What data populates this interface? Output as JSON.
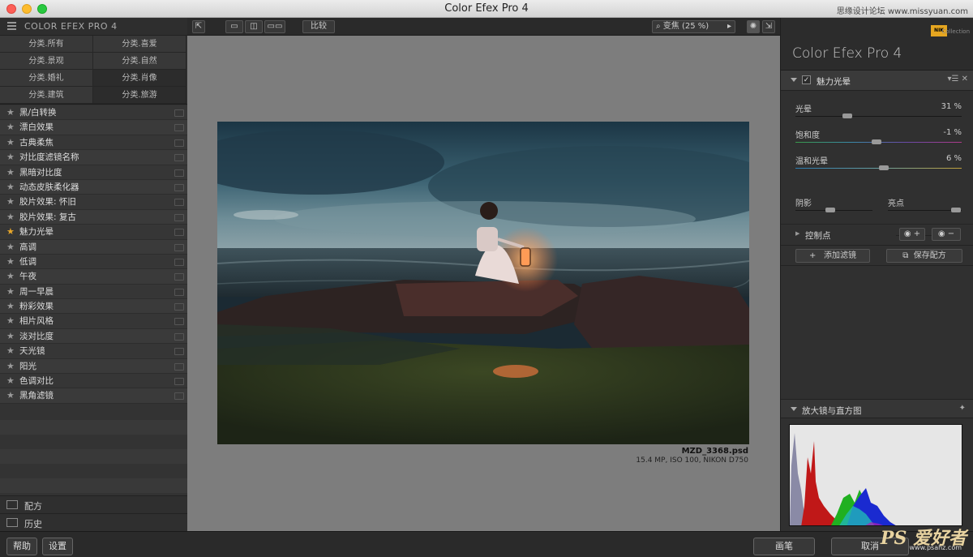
{
  "window": {
    "title": "Color Efex Pro 4",
    "watermark": "思缘设计论坛 www.missyuan.com"
  },
  "left": {
    "header": "COLOR EFEX PRO 4",
    "categories": [
      "分类.所有",
      "分类.喜爱",
      "分类.景观",
      "分类.自然",
      "分类.婚礼",
      "分类.肖像",
      "分类.建筑",
      "分类.旅游"
    ],
    "filters": [
      "黑/白转换",
      "漂白效果",
      "古典柔焦",
      "对比度滤镜名称",
      "黑暗对比度",
      "动态皮肤柔化器",
      "胶片效果: 怀旧",
      "胶片效果: 复古",
      "魅力光晕",
      "高调",
      "低调",
      "午夜",
      "周一早晨",
      "粉彩效果",
      "相片风格",
      "淡对比度",
      "天光镜",
      "阳光",
      "色调对比",
      "黑角滤镜"
    ],
    "active_filter": "魅力光晕",
    "recipes": "配方",
    "history": "历史"
  },
  "toolbar": {
    "compare": "比较",
    "zoom": "变焦 (25 %)"
  },
  "image": {
    "filename": "MZD_3368.psd",
    "meta": "15.4 MP, ISO 100, NIKON D750"
  },
  "right": {
    "nik_logo": "NIK",
    "nik_collection": "Collection",
    "app_name": "Color Efex Pro 4",
    "filter_name": "魅力光晕",
    "sliders": [
      {
        "label": "光晕",
        "value": "31 %",
        "pos": 0.31
      },
      {
        "label": "饱和度",
        "value": "-1 %",
        "pos": 0.49
      },
      {
        "label": "温和光晕",
        "value": "6 %",
        "pos": 0.53
      }
    ],
    "shadow": {
      "label": "阴影",
      "pos": 0.45
    },
    "highlight": {
      "label": "亮点",
      "pos": 0.92
    },
    "control_points": "控制点",
    "add_filter": "添加滤镜",
    "save_recipe": "保存配方",
    "loupe": "放大镜与直方图"
  },
  "bottom": {
    "help": "帮助",
    "settings": "设置",
    "brush": "画笔",
    "cancel": "取消",
    "watermark_ps": "PS 爱好者",
    "watermark_url": "www.psahz.com"
  }
}
